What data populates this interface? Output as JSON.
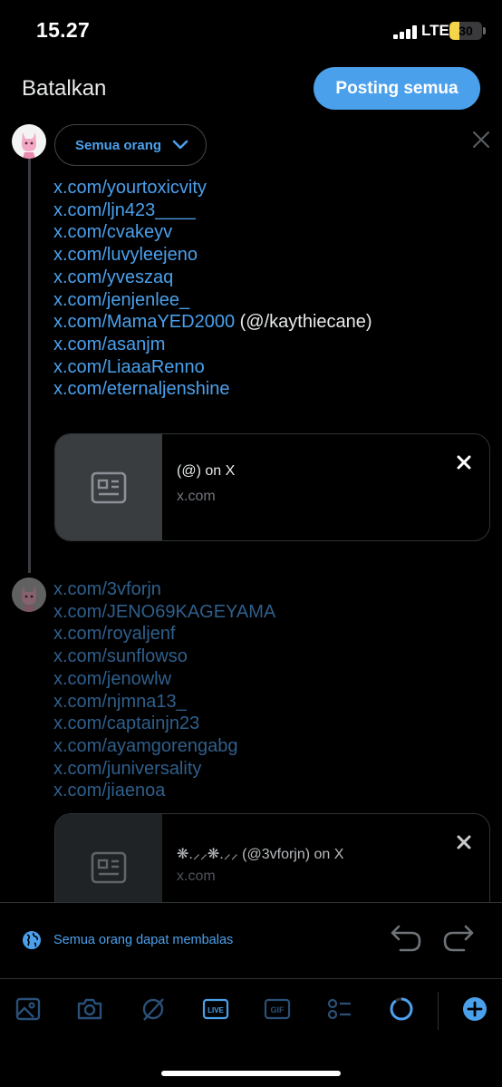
{
  "status_bar": {
    "time": "15.27",
    "network": "LTE",
    "battery": "30",
    "battery_level": 0.3
  },
  "header": {
    "cancel_label": "Batalkan",
    "post_all_label": "Posting semua"
  },
  "composer": {
    "audience_label": "Semua orang",
    "posts": [
      {
        "links": [
          {
            "text": "x.com/yourtoxicvity"
          },
          {
            "text": "x.com/ljn423____"
          },
          {
            "text": "x.com/cvakeyv"
          },
          {
            "text": "x.com/luvyleejeno"
          },
          {
            "text": "x.com/yveszaq"
          },
          {
            "text": "x.com/jenjenlee_"
          },
          {
            "text": "x.com/MamaYED2000",
            "suffix": " (@/kaythiecane)"
          },
          {
            "text": "x.com/asanjm"
          },
          {
            "text": "x.com/LiaaaRenno"
          },
          {
            "text": "x.com/eternaljenshine"
          }
        ],
        "card": {
          "title": "(@) on X",
          "domain": "x.com"
        }
      },
      {
        "links": [
          {
            "text": "x.com/3vforjn"
          },
          {
            "text": "x.com/JENO69KAGEYAMA"
          },
          {
            "text": "x.com/royaljenf"
          },
          {
            "text": "x.com/sunflowso"
          },
          {
            "text": "x.com/jenowlw"
          },
          {
            "text": "x.com/njmna13_"
          },
          {
            "text": "x.com/captainjn23"
          },
          {
            "text": "x.com/ayamgorengabg"
          },
          {
            "text": "x.com/juniversality"
          },
          {
            "text": "x.com/jiaenoa"
          }
        ],
        "card": {
          "title": "❋.⸝⸝❋.⸝⸝ (@3vforjn) on X",
          "domain": "x.com"
        }
      }
    ]
  },
  "reply_setting": {
    "label": "Semua orang dapat membalas"
  },
  "toolbar": {
    "icons": [
      "image-icon",
      "camera-icon",
      "grok-icon",
      "live-icon",
      "gif-icon",
      "poll-icon",
      "character-count-icon",
      "add-post-icon"
    ],
    "live_label": "LIVE",
    "gif_label": "GIF"
  },
  "colors": {
    "accent": "#4ba0ec",
    "background": "#000000",
    "border": "#2f3336",
    "muted_text": "#71767b"
  }
}
